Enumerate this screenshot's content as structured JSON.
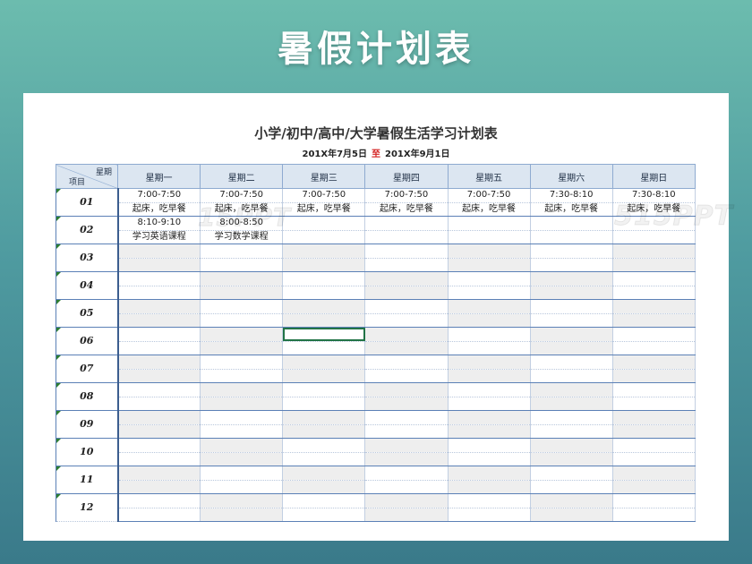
{
  "banner": {
    "title": "暑假计划表"
  },
  "sheet": {
    "title": "小学/初中/高中/大学暑假生活学习计划表",
    "start_date": "201X年7月5日",
    "to_label": "至",
    "end_date": "201X年9月1日",
    "corner_top": "星期",
    "corner_bottom": "项目",
    "days": [
      "星期一",
      "星期二",
      "星期三",
      "星期四",
      "星期五",
      "星期六",
      "星期日"
    ],
    "rows": [
      {
        "label": "01",
        "top": [
          "7:00-7:50",
          "7:00-7:50",
          "7:00-7:50",
          "7:00-7:50",
          "7:00-7:50",
          "7:30-8:10",
          "7:30-8:10"
        ],
        "bottom": [
          "起床，吃早餐",
          "起床，吃早餐",
          "起床，吃早餐",
          "起床，吃早餐",
          "起床，吃早餐",
          "起床，吃早餐",
          "起床，吃早餐"
        ]
      },
      {
        "label": "02",
        "top": [
          "8:10-9:10",
          "8:00-8:50",
          "",
          "",
          "",
          "",
          ""
        ],
        "bottom": [
          "学习英语课程",
          "学习数学课程",
          "",
          "",
          "",
          "",
          ""
        ]
      },
      {
        "label": "03",
        "top": [
          "",
          "",
          "",
          "",
          "",
          "",
          ""
        ],
        "bottom": [
          "",
          "",
          "",
          "",
          "",
          "",
          ""
        ]
      },
      {
        "label": "04",
        "top": [
          "",
          "",
          "",
          "",
          "",
          "",
          ""
        ],
        "bottom": [
          "",
          "",
          "",
          "",
          "",
          "",
          ""
        ]
      },
      {
        "label": "05",
        "top": [
          "",
          "",
          "",
          "",
          "",
          "",
          ""
        ],
        "bottom": [
          "",
          "",
          "",
          "",
          "",
          "",
          ""
        ]
      },
      {
        "label": "06",
        "top": [
          "",
          "",
          "",
          "",
          "",
          "",
          ""
        ],
        "bottom": [
          "",
          "",
          "",
          "",
          "",
          "",
          ""
        ]
      },
      {
        "label": "07",
        "top": [
          "",
          "",
          "",
          "",
          "",
          "",
          ""
        ],
        "bottom": [
          "",
          "",
          "",
          "",
          "",
          "",
          ""
        ]
      },
      {
        "label": "08",
        "top": [
          "",
          "",
          "",
          "",
          "",
          "",
          ""
        ],
        "bottom": [
          "",
          "",
          "",
          "",
          "",
          "",
          ""
        ]
      },
      {
        "label": "09",
        "top": [
          "",
          "",
          "",
          "",
          "",
          "",
          ""
        ],
        "bottom": [
          "",
          "",
          "",
          "",
          "",
          "",
          ""
        ]
      },
      {
        "label": "10",
        "top": [
          "",
          "",
          "",
          "",
          "",
          "",
          ""
        ],
        "bottom": [
          "",
          "",
          "",
          "",
          "",
          "",
          ""
        ]
      },
      {
        "label": "11",
        "top": [
          "",
          "",
          "",
          "",
          "",
          "",
          ""
        ],
        "bottom": [
          "",
          "",
          "",
          "",
          "",
          "",
          ""
        ]
      },
      {
        "label": "12",
        "top": [
          "",
          "",
          "",
          "",
          "",
          "",
          ""
        ],
        "bottom": [
          "",
          "",
          "",
          "",
          "",
          "",
          ""
        ]
      }
    ]
  },
  "watermarks": [
    "515PPT",
    "15PPT"
  ]
}
